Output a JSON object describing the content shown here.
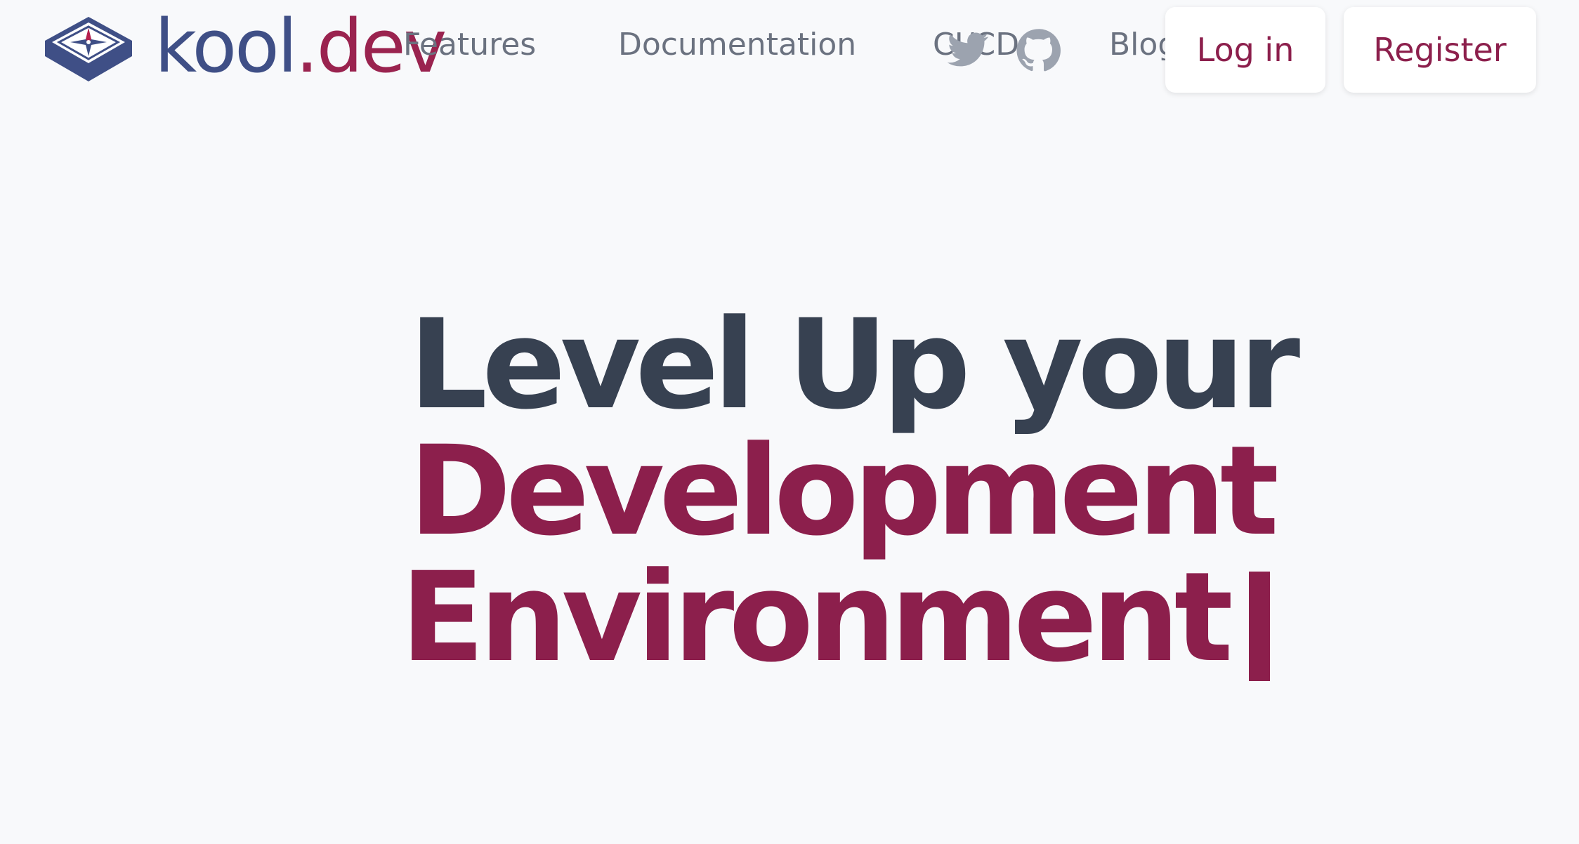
{
  "header": {
    "logo": {
      "text_main": "kool",
      "text_accent": ".dev",
      "icon": "kool-compass-logo-icon"
    },
    "nav": {
      "features": "Features",
      "documentation": "Documentation",
      "cicd": "CI/CD",
      "blog": "Blog"
    },
    "social": {
      "twitter_icon": "twitter-icon",
      "github_icon": "github-icon"
    },
    "buttons": {
      "login": "Log in",
      "register": "Register"
    }
  },
  "hero": {
    "line1": "Level Up your",
    "line2": "Development",
    "line3": "Environment"
  },
  "colors": {
    "background": "#f8f9fb",
    "brand_blue": "#3f4f86",
    "brand_crimson": "#8c1f4c",
    "heading_dark": "#374151",
    "nav_gray": "#6b7280"
  }
}
